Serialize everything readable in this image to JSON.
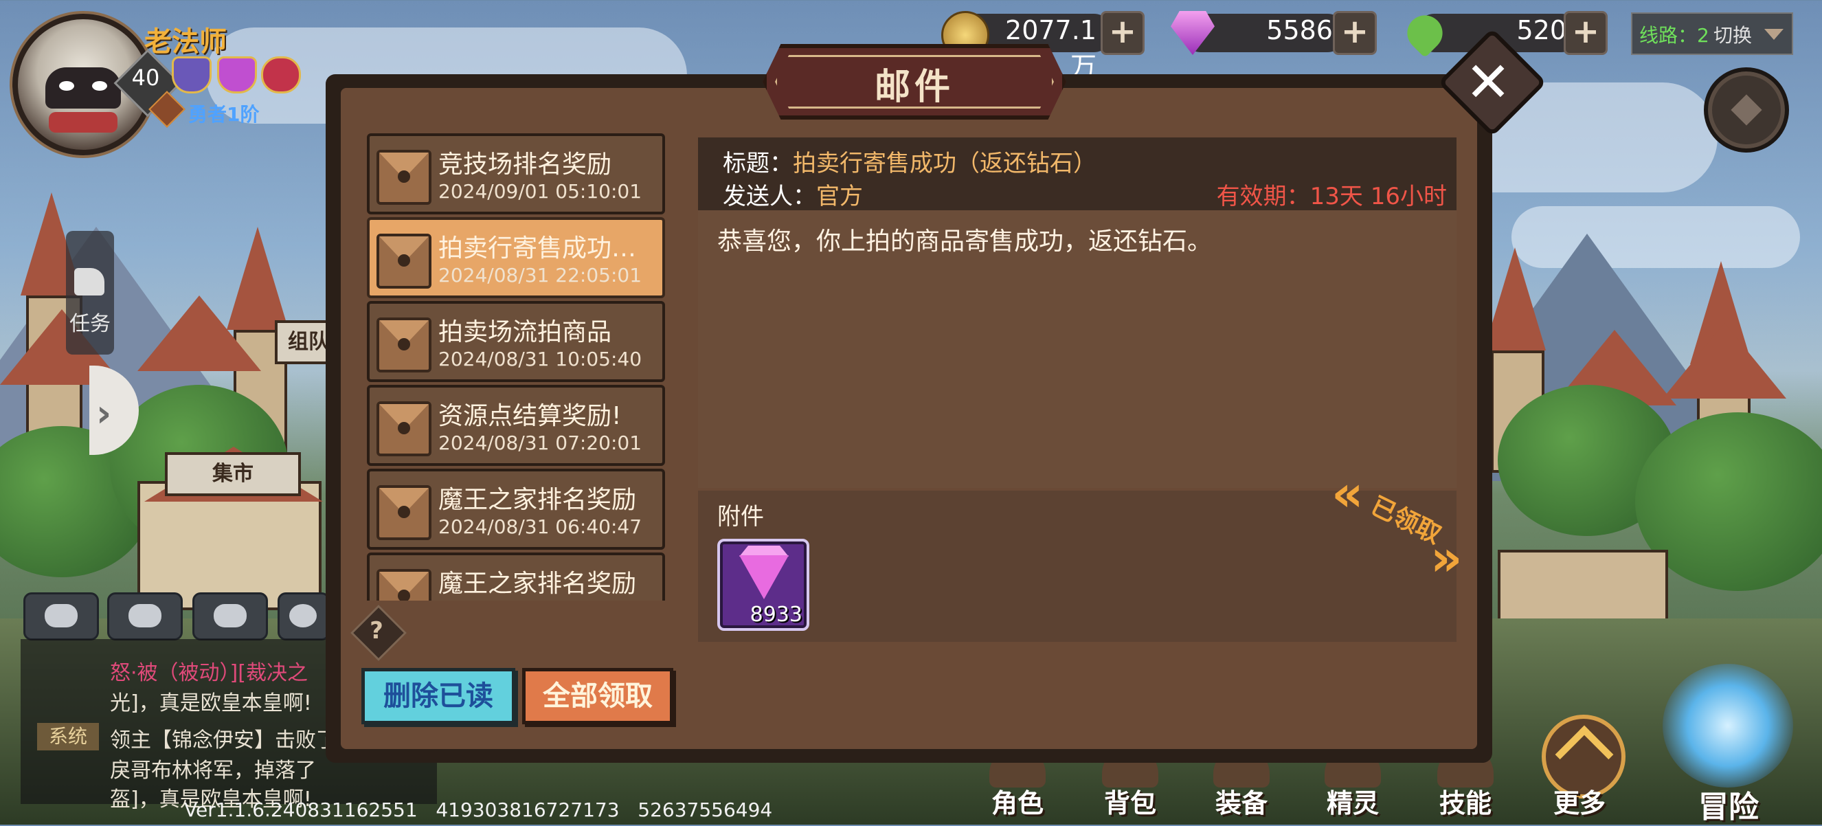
{
  "player": {
    "name": "老法师",
    "level": "40",
    "rank_badge": "1",
    "title": "勇者1阶"
  },
  "resources": {
    "gold": "2077.1万",
    "diamond": "5586",
    "stamina": "520"
  },
  "server_line": {
    "label": "线路：2",
    "switch_label": "切换"
  },
  "sidebar": {
    "task_label": "任务",
    "team_sign": "组队",
    "market_sign": "集市"
  },
  "mail_dialog": {
    "title": "邮件",
    "mails": [
      {
        "title": "竞技场排名奖励",
        "date": "2024/09/01 05:10:01"
      },
      {
        "title": "拍卖行寄售成功…",
        "date": "2024/08/31 22:05:01"
      },
      {
        "title": "拍卖场流拍商品",
        "date": "2024/08/31 10:05:40"
      },
      {
        "title": "资源点结算奖励!",
        "date": "2024/08/31 07:20:01"
      },
      {
        "title": "魔王之家排名奖励",
        "date": "2024/08/31 06:40:47"
      },
      {
        "title": "魔王之家排名奖励",
        "date": ""
      }
    ],
    "help_label": "?",
    "delete_read_label": "删除已读",
    "claim_all_label": "全部领取",
    "detail": {
      "subject_label": "标题：",
      "subject": "拍卖行寄售成功（返还钻石）",
      "sender_label": "发送人：",
      "sender": "官方",
      "expiry": "有效期：13天 16小时",
      "body": "恭喜您，你上拍的商品寄售成功，返还钻石。",
      "attachment_label": "附件",
      "attachment_count": "8933",
      "claimed_label": "已领取"
    }
  },
  "chat": {
    "line1_a": "怒·被（被动）]",
    "line1_b": "[裁决之",
    "line2": "光]，真是欧皇本皇啊!",
    "system_tag": "系统",
    "line3": "领主【锦念伊安】击败了",
    "line4": "戾哥布林将军，掉落了",
    "line5": "盔]，真是欧皇本皇啊!"
  },
  "version_text": "Ver1.1.6.240831162551   419303816727173   52637556494",
  "bottom_nav": [
    "角色",
    "背包",
    "装备",
    "精灵",
    "技能",
    "更多",
    "冒险"
  ],
  "colors": {
    "accent_gold": "#f2b86a",
    "expiry_red": "#f05548",
    "selected_mail": "#e7a667",
    "delete_button": "#62d0dd",
    "claim_button": "#e07a4a"
  }
}
